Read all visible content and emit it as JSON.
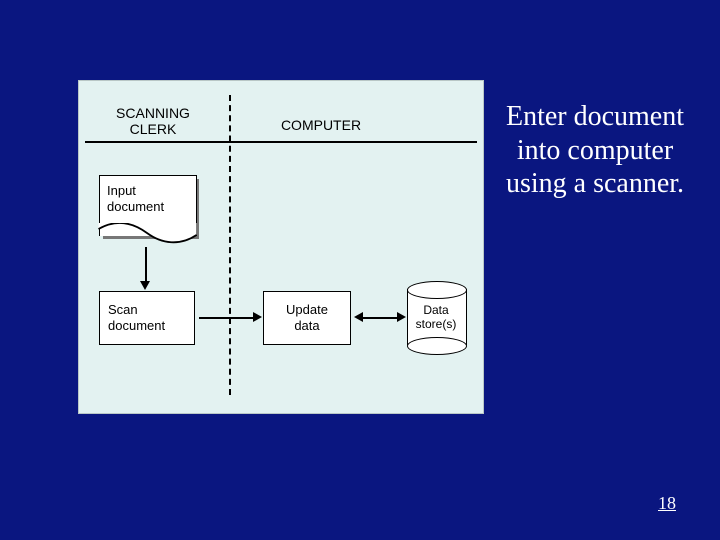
{
  "swimlanes": {
    "left_header": "SCANNING\nCLERK",
    "right_header": "COMPUTER"
  },
  "nodes": {
    "input_doc": "Input\ndocument",
    "scan_doc": "Scan\ndocument",
    "update_data": "Update\ndata",
    "data_store": "Data\nstore(s)"
  },
  "caption": "Enter document into computer using a scanner.",
  "page_number": "18",
  "chart_data": {
    "type": "diagram",
    "title": "Enter document into computer using a scanner.",
    "swimlanes": [
      "SCANNING CLERK",
      "COMPUTER"
    ],
    "nodes": [
      {
        "id": "input_doc",
        "label": "Input document",
        "type": "document",
        "lane": "SCANNING CLERK"
      },
      {
        "id": "scan_doc",
        "label": "Scan document",
        "type": "process",
        "lane": "SCANNING CLERK"
      },
      {
        "id": "update_data",
        "label": "Update data",
        "type": "process",
        "lane": "COMPUTER"
      },
      {
        "id": "data_store",
        "label": "Data store(s)",
        "type": "datastore",
        "lane": "COMPUTER"
      }
    ],
    "edges": [
      {
        "from": "input_doc",
        "to": "scan_doc",
        "dir": "forward"
      },
      {
        "from": "scan_doc",
        "to": "update_data",
        "dir": "forward"
      },
      {
        "from": "update_data",
        "to": "data_store",
        "dir": "both"
      }
    ]
  }
}
